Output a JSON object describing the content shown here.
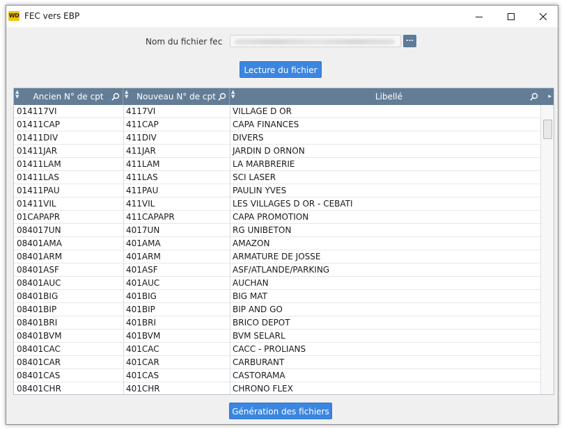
{
  "window": {
    "title": "FEC vers EBP",
    "icon_text": "WD"
  },
  "form": {
    "file_label": "Nom du fichier fec",
    "browse_label": "...",
    "read_button": "Lecture du fichier",
    "generate_button": "Génération des fichiers"
  },
  "table": {
    "columns": [
      "Ancien N° de cpt",
      "Nouveau N° de cpt",
      "Libellé"
    ],
    "rows": [
      [
        "014117VI",
        "4117VI",
        "VILLAGE D OR"
      ],
      [
        "01411CAP",
        "411CAP",
        "CAPA FINANCES"
      ],
      [
        "01411DIV",
        "411DIV",
        "DIVERS"
      ],
      [
        "01411JAR",
        "411JAR",
        "JARDIN D ORNON"
      ],
      [
        "01411LAM",
        "411LAM",
        "LA MARBRERIE"
      ],
      [
        "01411LAS",
        "411LAS",
        "SCI LASER"
      ],
      [
        "01411PAU",
        "411PAU",
        "PAULIN YVES"
      ],
      [
        "01411VIL",
        "411VIL",
        "LES VILLAGES D OR - CEBATI"
      ],
      [
        "01CAPAPR",
        "411CAPAPR",
        "CAPA PROMOTION"
      ],
      [
        "084017UN",
        "4017UN",
        "RG UNIBETON"
      ],
      [
        "08401AMA",
        "401AMA",
        "AMAZON"
      ],
      [
        "08401ARM",
        "401ARM",
        "ARMATURE DE JOSSE"
      ],
      [
        "08401ASF",
        "401ASF",
        "ASF/ATLANDE/PARKING"
      ],
      [
        "08401AUC",
        "401AUC",
        "AUCHAN"
      ],
      [
        "08401BIG",
        "401BIG",
        "BIG MAT"
      ],
      [
        "08401BIP",
        "401BIP",
        "BIP AND GO"
      ],
      [
        "08401BRI",
        "401BRI",
        "BRICO DEPOT"
      ],
      [
        "08401BVM",
        "401BVM",
        "BVM SELARL"
      ],
      [
        "08401CAC",
        "401CAC",
        "CACC - PROLIANS"
      ],
      [
        "08401CAR",
        "401CAR",
        "CARBURANT"
      ],
      [
        "08401CAS",
        "401CAS",
        "CASTORAMA"
      ],
      [
        "08401CHR",
        "401CHR",
        "CHRONO FLEX"
      ]
    ]
  },
  "colors": {
    "header_bg": "#637d96",
    "button_bg": "#3b86e0",
    "icon_bg": "#f5c400"
  }
}
